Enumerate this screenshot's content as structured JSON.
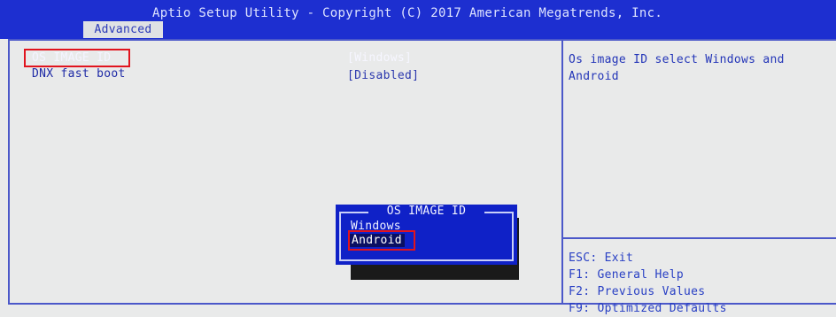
{
  "title": "Aptio Setup Utility - Copyright (C) 2017 American Megatrends, Inc.",
  "tab": "Advanced",
  "items": [
    {
      "label": "OS IMAGE ID",
      "value": "[Windows]"
    },
    {
      "label": "DNX fast boot",
      "value": "[Disabled]"
    }
  ],
  "help": "Os image ID select Windows and Android",
  "keys": [
    "ESC: Exit",
    "F1: General Help",
    "F2: Previous Values",
    "F9: Optimized Defaults"
  ],
  "popup": {
    "title": "OS IMAGE ID",
    "options": [
      "Windows",
      "Android"
    ],
    "selected": "Android"
  },
  "colors": {
    "title_bar": "#1d2fd0",
    "background": "#e9eaea",
    "accent_text": "#1e2aa6",
    "popup_bg": "#0f21c7",
    "annotation_red": "#e1141e"
  }
}
